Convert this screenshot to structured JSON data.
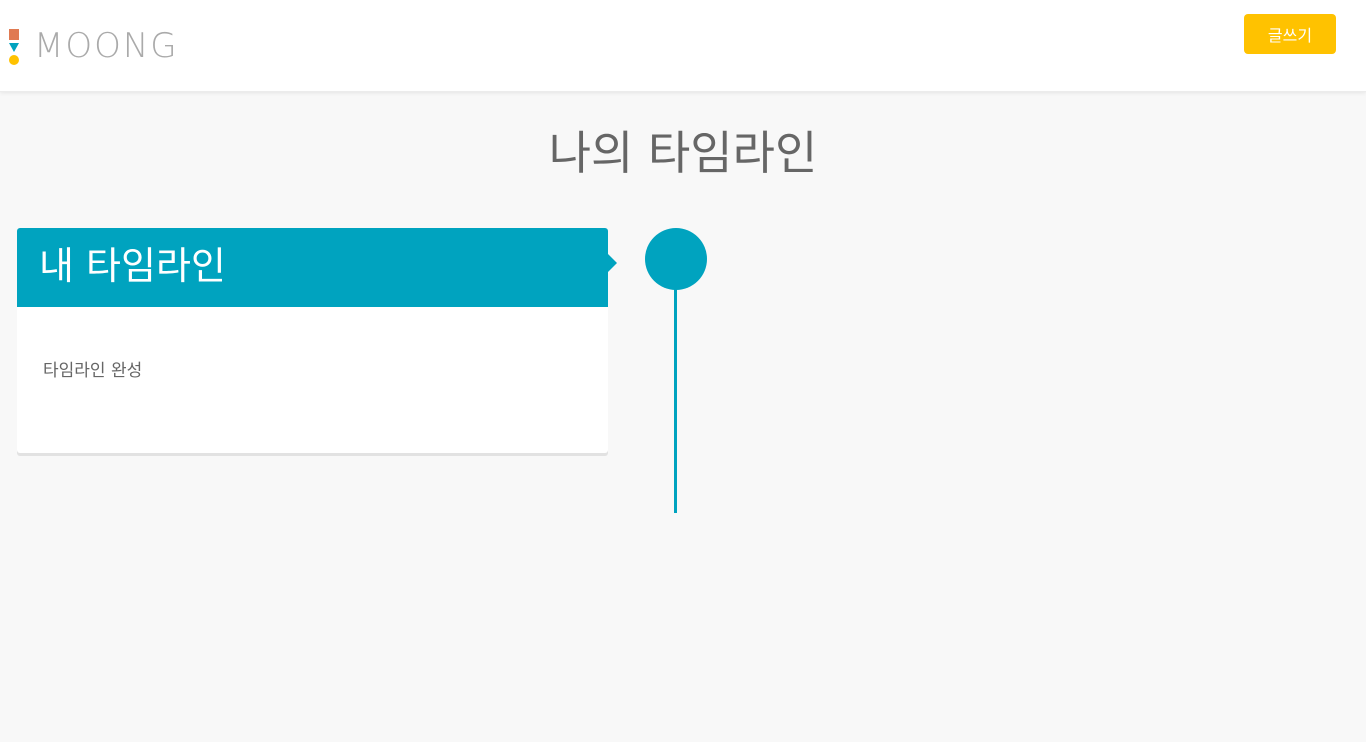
{
  "colors": {
    "accent": "#00a3bf",
    "button": "#ffc200",
    "logo_square": "#e07a52",
    "logo_triangle": "#00a3bf",
    "logo_dot": "#ffc200",
    "title_text": "#666666"
  },
  "header": {
    "logo_text": "MOONG",
    "write_button_label": "글쓰기"
  },
  "main": {
    "page_title": "나의 타임라인",
    "timeline": {
      "items": [
        {
          "title": "내 타임라인",
          "content": "타임라인 완성"
        }
      ]
    }
  }
}
